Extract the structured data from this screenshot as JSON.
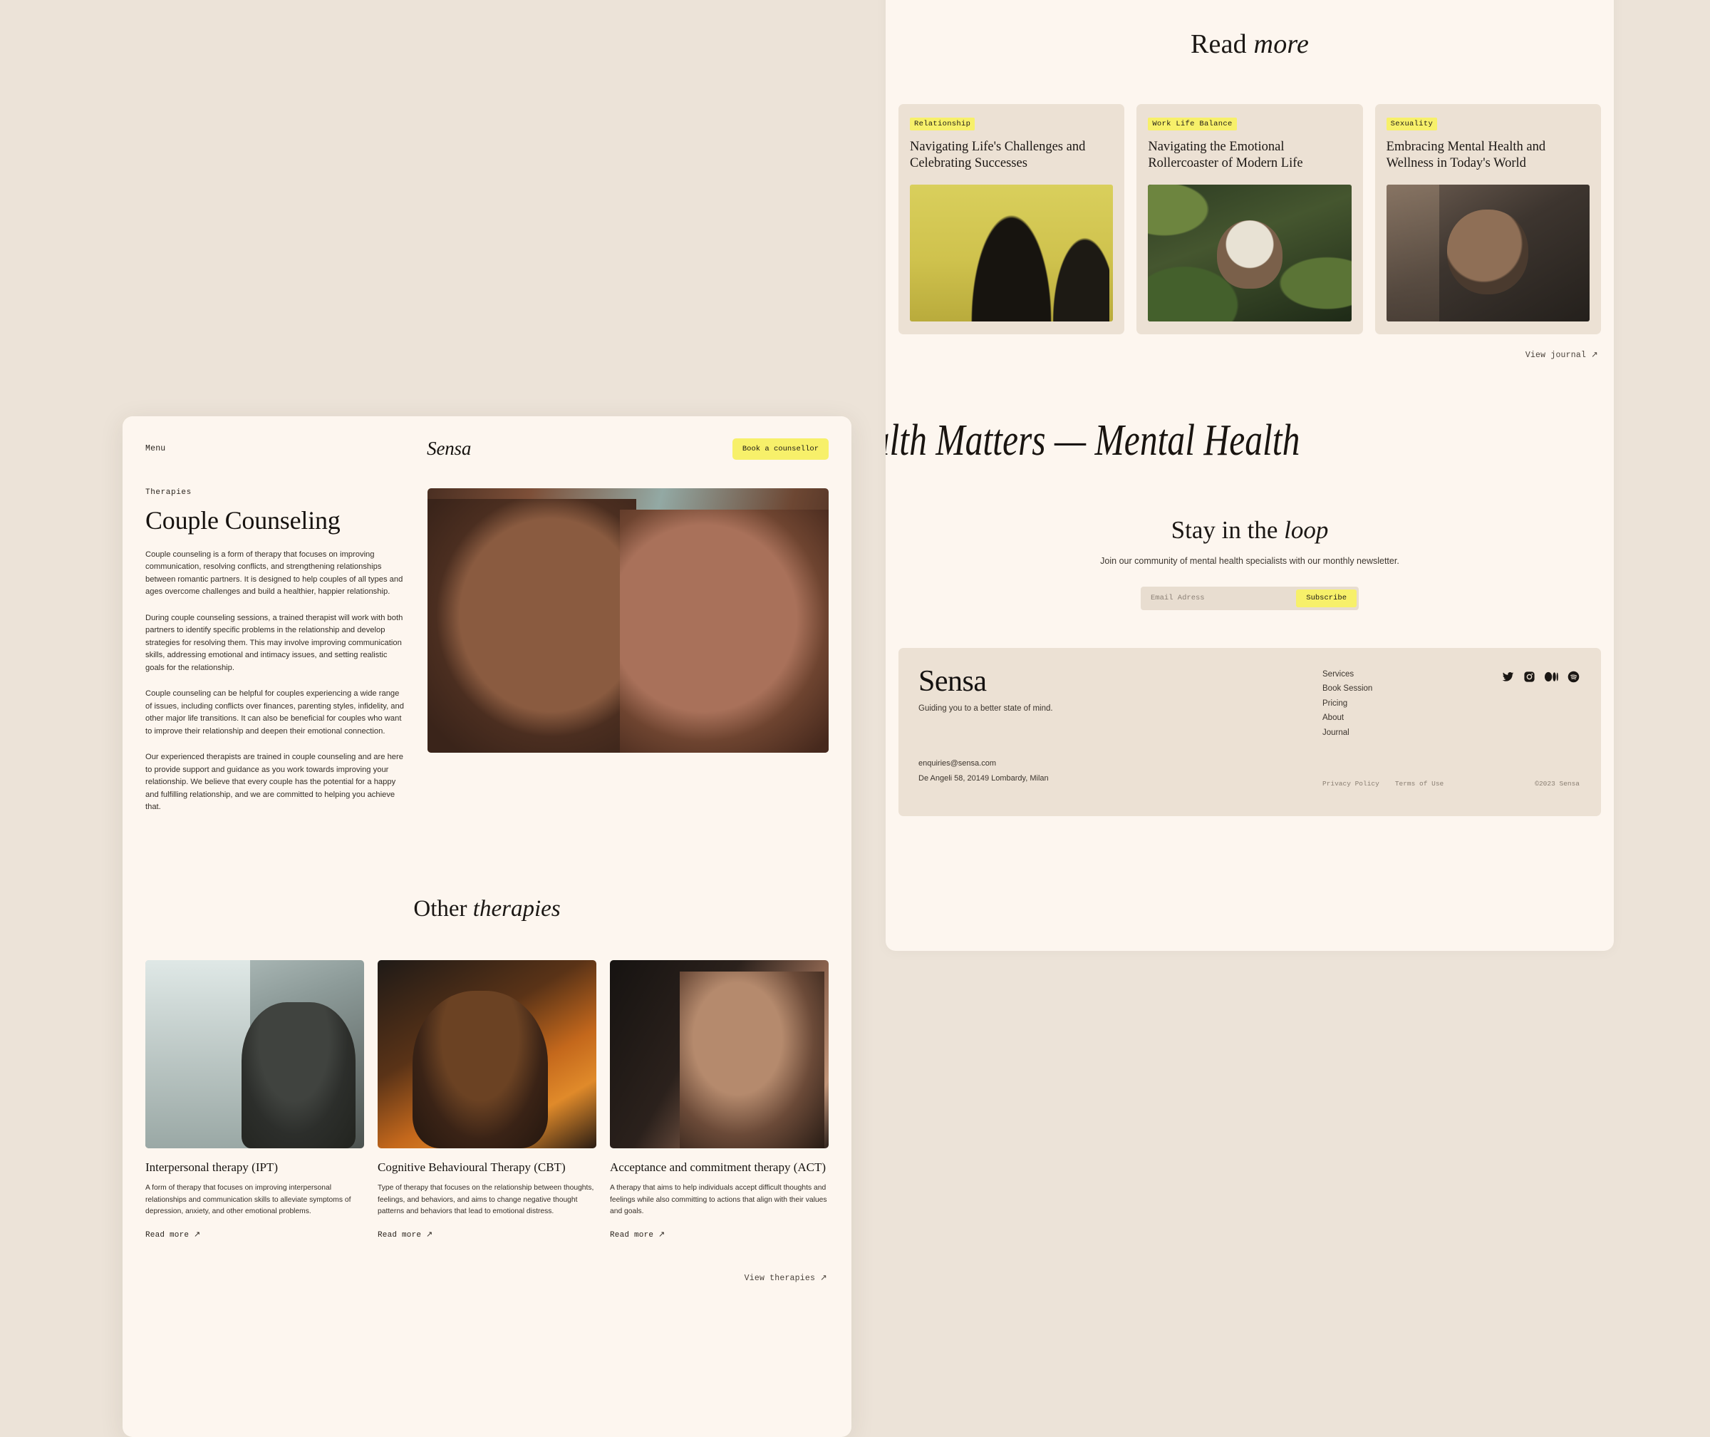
{
  "theme": {
    "page_bg": "#ece3d8",
    "panel_bg": "#fdf6ef",
    "card_bg": "#ece1d4",
    "accent_yellow": "#f7f06a",
    "text_dark": "#16120f"
  },
  "therapy_page": {
    "topbar": {
      "menu_label": "Menu",
      "brand": "Sensa",
      "cta_label": "Book a counsellor"
    },
    "hero": {
      "eyebrow": "Therapies",
      "title": "Couple Counseling",
      "paragraphs": [
        "Couple counseling is a form of therapy that focuses on improving communication, resolving conflicts, and strengthening relationships between romantic partners. It is designed to help couples of all types and ages overcome challenges and build a healthier, happier relationship.",
        "During couple counseling sessions, a trained therapist will work with both partners to identify specific problems in the relationship and develop strategies for resolving them. This may involve improving communication skills, addressing emotional and intimacy issues, and setting realistic goals for the relationship.",
        "Couple counseling can be helpful for couples experiencing a wide range of issues, including conflicts over finances, parenting styles, infidelity, and other major life transitions. It can also be beneficial for couples who want to improve their relationship and deepen their emotional connection.",
        "Our experienced therapists are trained in couple counseling and are here to provide support and guidance as you work towards improving your relationship. We believe that every couple has the potential for a happy and fulfilling relationship, and we are committed to helping you achieve that."
      ],
      "image_alt": "couple-embracing-photo"
    },
    "other_therapies": {
      "heading_regular": "Other",
      "heading_italic": "therapies",
      "view_all_label": "View therapies ↗",
      "cards": [
        {
          "title": "Interpersonal therapy (IPT)",
          "description": "A form of therapy that focuses on improving interpersonal relationships and communication skills to alleviate symptoms of depression, anxiety, and other emotional problems.",
          "read_more": "Read more ↗",
          "image_alt": "young-man-by-window-photo"
        },
        {
          "title": "Cognitive Behavioural Therapy (CBT)",
          "description": "Type of therapy that focuses on the relationship between thoughts, feelings, and behaviors, and aims to change negative thought patterns and behaviors that lead to emotional distress.",
          "read_more": "Read more ↗",
          "image_alt": "person-in-warm-orange-light-photo"
        },
        {
          "title": "Acceptance and commitment therapy (ACT)",
          "description": "A therapy that aims to help individuals accept difficult thoughts and feelings while also committing to actions that align with their values and goals.",
          "read_more": "Read more ↗",
          "image_alt": "man-face-half-lit-photo"
        }
      ]
    }
  },
  "journal_page": {
    "read_more_heading": {
      "regular": "Read",
      "italic": "more"
    },
    "articles": [
      {
        "tag": "Relationship",
        "title": "Navigating Life's Challenges and Celebrating Successes",
        "image_alt": "two-silhouettes-on-yellow-photo"
      },
      {
        "tag": "Work Life Balance",
        "title": "Navigating the Emotional Rollercoaster of Modern Life",
        "image_alt": "person-in-foliage-photo"
      },
      {
        "tag": "Sexuality",
        "title": "Embracing Mental Health and Wellness in Today's World",
        "image_alt": "woman-with-glasses-photo"
      }
    ],
    "view_journal_label": "View journal ↗",
    "marquee_text": "Mental Health Matters — Mental Health Matters — Mental Health Matters — Mental Health Matters — ",
    "newsletter": {
      "heading_regular": "Stay in the",
      "heading_italic": "loop",
      "subtitle": "Join our community of mental health specialists with our monthly newsletter.",
      "email_placeholder": "Email Adress",
      "email_value": "",
      "subscribe_label": "Subscribe"
    },
    "footer": {
      "brand": "Sensa",
      "tagline": "Guiding you to a better state of mind.",
      "nav": [
        "Services",
        "Book Session",
        "Pricing",
        "About",
        "Journal"
      ],
      "email": "enquiries@sensa.com",
      "address": "De Angeli 58, 20149 Lombardy, Milan",
      "legal": [
        "Privacy Policy",
        "Terms of Use"
      ],
      "copyright": "©2023 Sensa",
      "social": [
        "twitter-icon",
        "instagram-icon",
        "medium-icon",
        "spotify-icon"
      ]
    }
  }
}
